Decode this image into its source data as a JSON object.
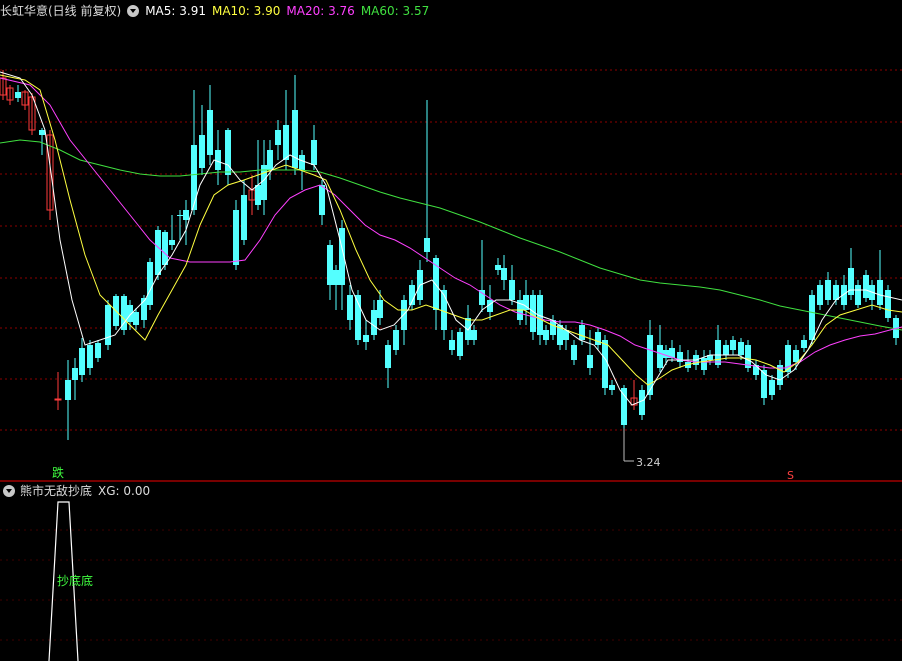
{
  "main_header": {
    "stock_title": "长虹华意(日线 前复权)",
    "ma5_label": "MA5: 3.91",
    "ma10_label": "MA10: 3.90",
    "ma20_label": "MA20: 3.76",
    "ma60_label": "MA60: 3.57"
  },
  "sub_header": {
    "indicator_title": "熊市无敌抄底",
    "xg_label": "XG: 0.00"
  },
  "annotations": {
    "low_price": "3.24",
    "signal_die": "跌",
    "signal_s": "S",
    "signal_buy": "抄底底"
  },
  "colors": {
    "up": "#ff3c3c",
    "down": "#54ffff",
    "ma5": "#ffffff",
    "ma10": "#ffff40",
    "ma20": "#ff40ff",
    "ma60": "#40e040",
    "grid": "#8b0000"
  }
}
